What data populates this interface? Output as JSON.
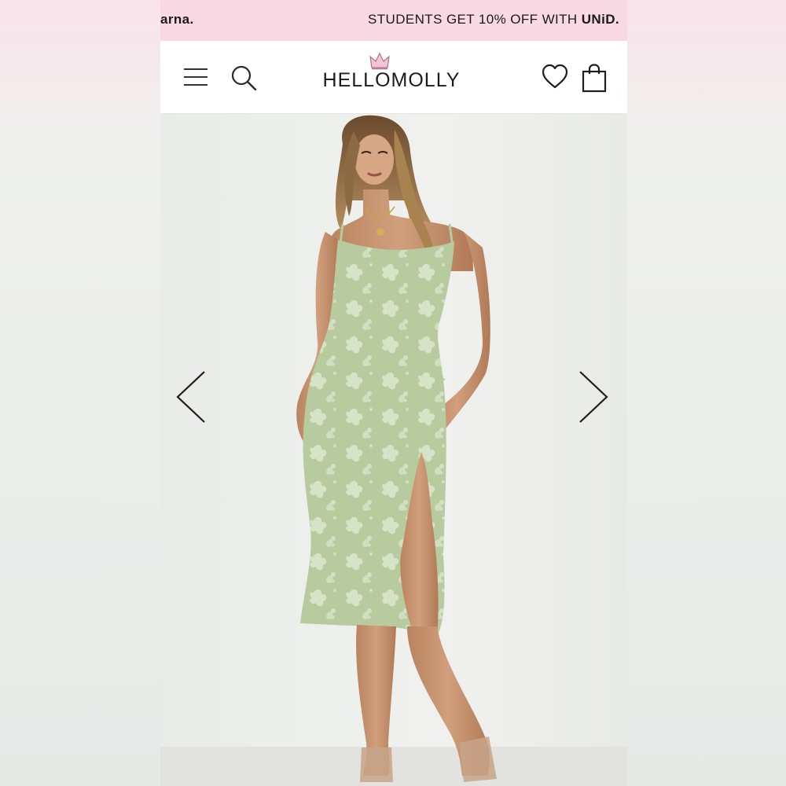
{
  "promo": {
    "left_text": "arna.",
    "right_prefix": "STUDENTS GET 10% OFF WITH ",
    "right_brand": "UNiD."
  },
  "header": {
    "logo_text": "HELLOMOLLY",
    "menu_icon": "hamburger-menu-icon",
    "search_icon": "search-icon",
    "wishlist_icon": "heart-icon",
    "bag_icon": "shopping-bag-icon"
  },
  "gallery": {
    "prev_icon": "chevron-left-icon",
    "next_icon": "chevron-right-icon",
    "image_alt": "Model wearing sage green floral jacquard midi dress with thigh split"
  },
  "colors": {
    "promo_bg": "#f9d9e3",
    "dress_green": "#b9cba0",
    "crown_pink": "#e58fb4"
  }
}
